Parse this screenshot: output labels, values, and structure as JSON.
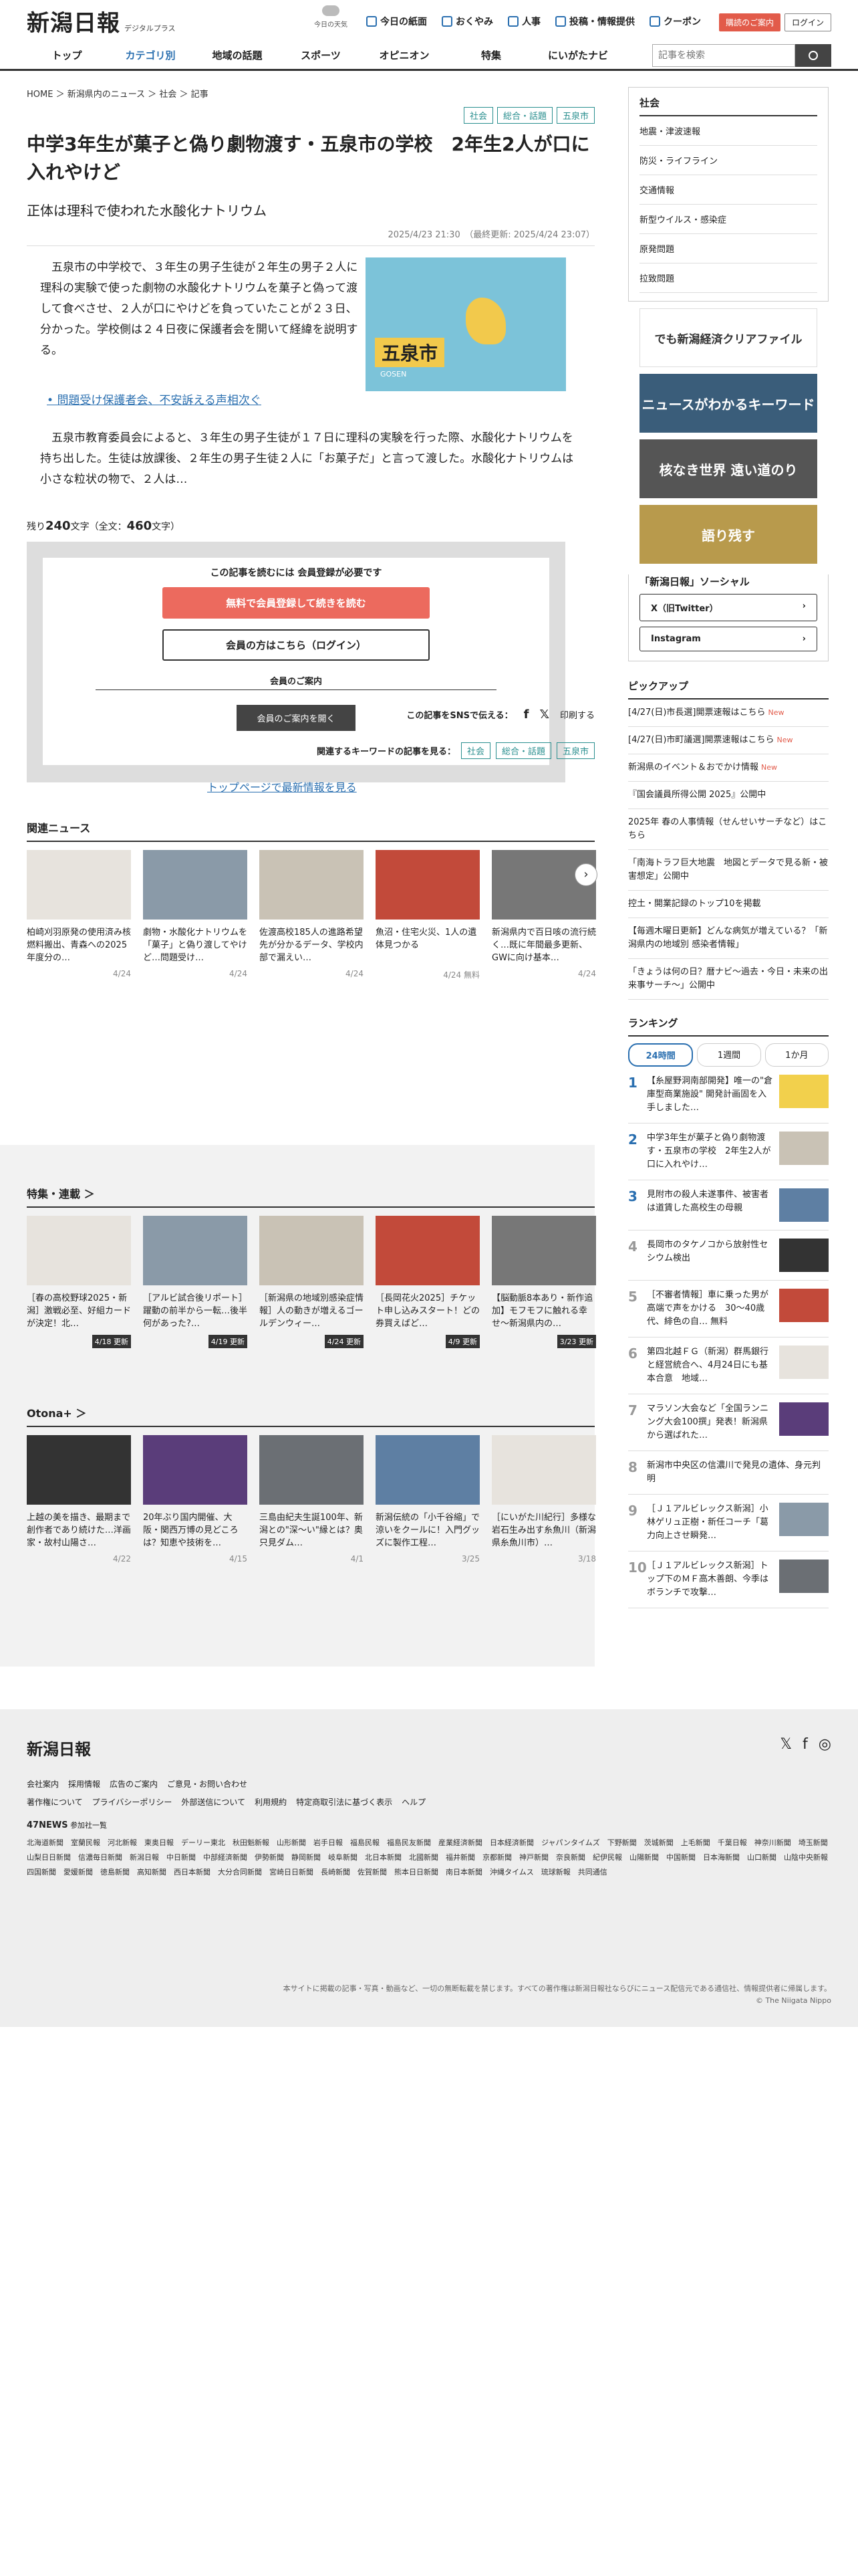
{
  "header": {
    "logo": "新潟日報",
    "logo_sub": "デジタルプラス",
    "weather": "今日の天気",
    "links": [
      "今日の紙面",
      "おくやみ",
      "人事",
      "投稿・情報提供",
      "クーポン"
    ],
    "register": "購読のご案内",
    "login": "ログイン"
  },
  "nav": {
    "items": [
      "トップ",
      "カテゴリ別",
      "地域の話題",
      "スポーツ",
      "オピニオン",
      "特集",
      "にいがたナビ"
    ],
    "search_placeholder": "記事を検索"
  },
  "breadcrumb": "HOME ＞ 新潟県内のニュース ＞ 社会 ＞ 記事",
  "article": {
    "tags": [
      "社会",
      "総合・話題",
      "五泉市"
    ],
    "title": "中学3年生が菓子と偽り劇物渡す・五泉市の学校　2年生2人が口に入れやけど",
    "subtitle": "正体は理科で使われた水酸化ナトリウム",
    "date": "2025/4/23 21:30　（最終更新: 2025/4/24 23:07）",
    "lead": "五泉市の中学校で、３年生の男子生徒が２年生の男子２人に理科の実験で使った劇物の水酸化ナトリウムを菓子と偽って渡して食べさせ、２人が口にやけどを負っていたことが２３日、分かった。学校側は２４日夜に保護者会を開いて経緯を説明する。",
    "map_label": "五泉市",
    "map_sub": "GOSEN",
    "related_link": "問題受け保護者会、不安訴える声相次ぐ",
    "body": "五泉市教育委員会によると、３年生の男子生徒が１７日に理科の実験を行った際、水酸化ナトリウムを持ち出した。生徒は放課後、２年生の男子生徒２人に「お菓子だ」と言って渡した。水酸化ナトリウムは小さな粒状の物で、２人は…",
    "remain": "残り",
    "remain_n": "240",
    "remain_unit": "文字（全文：",
    "total_n": "460",
    "total_unit": "文字）"
  },
  "paywall": {
    "need": "この記事を読むには 会員登録が必要です",
    "signup": "無料で会員登録して続きを読む",
    "login": "会員の方はこちら（ログイン）",
    "guide": "会員のご案内",
    "open": "会員のご案内を開く"
  },
  "share": {
    "label": "この記事をSNSで伝える：",
    "print": "印刷する",
    "kw_label": "関連するキーワードの記事を見る："
  },
  "toplink": "トップページで最新情報を見る",
  "related": {
    "title": "関連ニュース",
    "items": [
      {
        "t": "柏崎刈羽原発の使用済み核燃料搬出、青森への2025年度分の…",
        "d": "4/24"
      },
      {
        "t": "劇物・水酸化ナトリウムを「菓子」と偽り渡してやけど…問題受け…",
        "d": "4/24"
      },
      {
        "t": "佐渡高校185人の進路希望先が分かるデータ、学校内部で漏えい…",
        "d": "4/24"
      },
      {
        "t": "魚沼・住宅火災、1人の遺体見つかる",
        "d": "4/24 無料"
      },
      {
        "t": "新潟県内で百日咳の流行続く…既に年間最多更新、GWに向け基本…",
        "d": "4/24"
      }
    ]
  },
  "feature": {
    "title": "特集・連載 ＞",
    "items": [
      {
        "t": "［春の高校野球2025・新潟］激戦必至、好組カードが決定！北…",
        "d": "4/18 更新"
      },
      {
        "t": "［アルビ試合後リポート］躍動の前半から一転…後半何があった?…",
        "d": "4/19 更新"
      },
      {
        "t": "［新潟県の地域別感染症情報］人の動きが増えるゴールデンウィー…",
        "d": "4/24 更新"
      },
      {
        "t": "［長岡花火2025］チケット申し込みスタート！どの券買えばど…",
        "d": "4/9 更新"
      },
      {
        "t": "【脳動脈8本あり・新作追加】モフモフに触れる幸せ〜新潟県内の…",
        "d": "3/23 更新"
      }
    ]
  },
  "otona": {
    "title": "Otona+ ＞",
    "items": [
      {
        "t": "上越の美を描き、最期まで創作者であり続けた…洋画家・故村山陽さ…",
        "d": "4/22"
      },
      {
        "t": "20年ぶり国内開催、大阪・関西万博の見どころは？知恵や技術を…",
        "d": "4/15"
      },
      {
        "t": "三島由紀夫生誕100年、新潟との\"深〜い\"縁とは？奥只見ダム…",
        "d": "4/1"
      },
      {
        "t": "新潟伝統の「小千谷縮」で涼いをクールに！入門グッズに製作工程…",
        "d": "3/25"
      },
      {
        "t": "［にいがた川紀行］多様な岩石生み出す糸魚川（新潟県糸魚川市）…",
        "d": "3/18"
      }
    ]
  },
  "sidebar": {
    "box_title": "社会",
    "box_items": [
      "地震・津波速報",
      "防災・ライフライン",
      "交通情報",
      "新型ウイルス・感染症",
      "原発問題",
      "拉致問題"
    ],
    "banners": [
      "でも新潟経済クリアファイル",
      "ニュースがわかるキーワード",
      "核なき世界 遠い道のり",
      "語り残す"
    ],
    "social_title": "「新潟日報」ソーシャル",
    "social": [
      "X（旧Twitter）",
      "Instagram"
    ],
    "pick_title": "ピックアップ",
    "pick": [
      {
        "t": "[4/27(日)市長選]開票速報はこちら",
        "n": "New"
      },
      {
        "t": "[4/27(日)市町議選]開票速報はこちら",
        "n": "New"
      },
      {
        "t": "新潟県のイベント＆おでかけ情報",
        "n": "New"
      },
      {
        "t": "『国会議員所得公開 2025』公開中",
        "n": ""
      },
      {
        "t": "2025年 春の人事情報（せんせいサーチなど）はこちら",
        "n": ""
      },
      {
        "t": "「南海トラフ巨大地震　地図とデータで見る新・被害想定」公開中",
        "n": ""
      },
      {
        "t": "控土・開業記録のトップ10を掲載",
        "n": ""
      },
      {
        "t": "【毎週木曜日更新】どんな病気が増えている？「新潟県内の地域別 感染者情報」",
        "n": ""
      },
      {
        "t": "「きょうは何の日？暦ナビ〜過去・今日・未来の出来事サーチ〜」公開中",
        "n": ""
      }
    ],
    "rank_title": "ランキング",
    "rank_tabs": [
      "24時間",
      "1週間",
      "1か月"
    ],
    "rank": [
      "【糸屋野洞南部開発】唯一の\"倉庫型商業施設\" 開発計画固を入手しました…",
      "中学3年生が菓子と偽り劇物渡す・五泉市の学校　2年生2人が口に入れやけ…",
      "見附市の殺人未遂事件、被害者は道賃した高校生の母親",
      "長岡市のタケノコから放射性セシウム検出",
      "［不審者情報］車に乗った男が高端で声をかける　30〜40歳代、緋色の自… 無料",
      "第四北越ＦＧ（新潟）群馬銀行と経営統合へ、4月24日にも基本合意　地域…",
      "マラソン大会など「全国ランニング大会100撰」発表！新潟県から選ばれた…",
      "新潟市中央区の信濃川で発見の遺体、身元判明",
      "［Ｊ１アルビレックス新潟］小林ゲリュ正樹・新任コーチ「葛力向上させ瞬発…",
      "［Ｊ１アルビレックス新潟］トップ下のＭＦ高木善朗、今季はボランチで攻撃…"
    ]
  },
  "footer": {
    "logo": "新潟日報",
    "row1": [
      "会社案内",
      "採用情報",
      "広告のご案内",
      "ご意見・お問い合わせ"
    ],
    "row2": [
      "著作権について",
      "プライバシーポリシー",
      "外部送信について",
      "利用規約",
      "特定商取引法に基づく表示",
      "ヘルプ"
    ],
    "n47": "47NEWS",
    "n47sub": "参加社一覧",
    "papers": "北海道新聞　室蘭民報　河北新報　東奥日報　デーリー東北　秋田魁新報　山形新聞　岩手日報　福島民報　福島民友新聞　産業経済新聞　日本経済新聞　ジャパンタイムズ　下野新聞　茨城新聞　上毛新聞　千葉日報　神奈川新聞　埼玉新聞　山梨日日新聞　信濃毎日新聞　新潟日報　中日新聞　中部経済新聞　伊勢新聞　静岡新聞　岐阜新聞　北日本新聞　北國新聞　福井新聞　京都新聞　神戸新聞　奈良新聞　紀伊民報　山陽新聞　中国新聞　日本海新聞　山口新聞　山陰中央新報　四国新聞　愛媛新聞　徳島新聞　高知新聞　西日本新聞　大分合同新聞　宮崎日日新聞　長崎新聞　佐賀新聞　熊本日日新聞　南日本新聞　沖縄タイムス　琉球新報　共同通信",
    "copy": "本サイトに掲載の記事・写真・動画など、一切の無断転載を禁じます。すべての著作権は新潟日報社ならびにニュース配信元である通信社、情報提供者に帰属します。",
    "copy2": "© The Niigata Nippo"
  }
}
